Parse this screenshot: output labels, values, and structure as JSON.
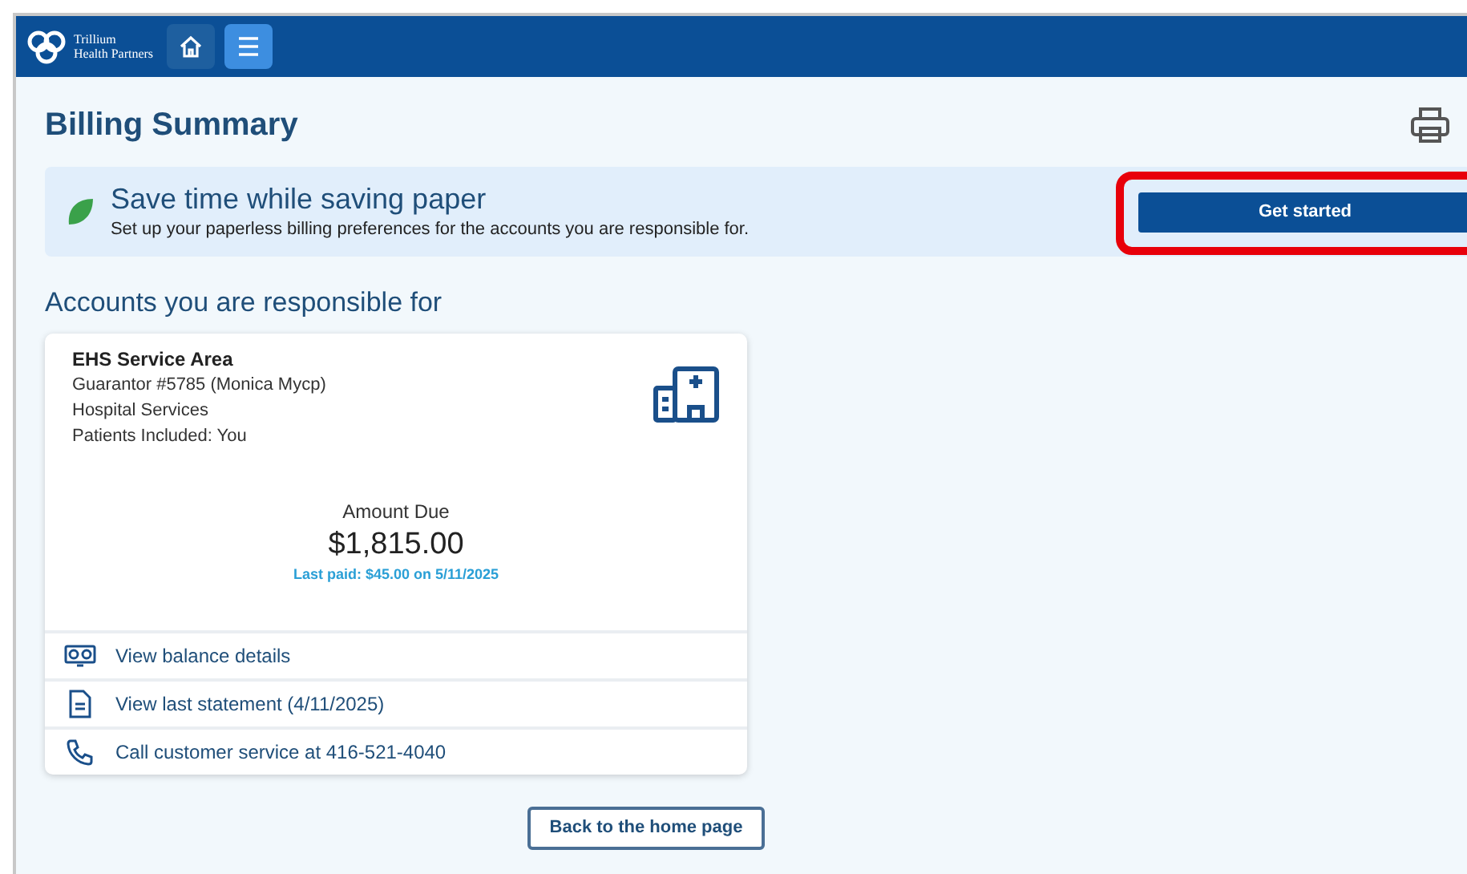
{
  "header": {
    "logo_lines": [
      "Trillium",
      "Health Partners"
    ],
    "nav": [
      {
        "kind": "home",
        "selected": false
      },
      {
        "kind": "menu",
        "selected": true
      }
    ]
  },
  "page_title": "Billing Summary",
  "promo": {
    "title": "Save time while saving paper",
    "text": "Set up your paperless billing preferences for the accounts you are responsible for.",
    "button": "Get started",
    "highlighted": true
  },
  "section_title": "Accounts you are responsible for",
  "account": {
    "name": "EHS Service Area",
    "details": [
      "Guarantor #5785 (Monica Mycp)",
      "Hospital Services",
      "Patients Included: You"
    ],
    "amount_label": "Amount Due",
    "amount": "$1,815.00",
    "last_paid": "Last paid: $45.00 on 5/11/2025",
    "actions": [
      {
        "kind": "balance",
        "label": "View balance details"
      },
      {
        "kind": "statement",
        "label": "View last statement (4/11/2025)"
      },
      {
        "kind": "phone",
        "label": "Call customer service at 416-521-4040"
      }
    ]
  },
  "back_button": "Back to the home page"
}
